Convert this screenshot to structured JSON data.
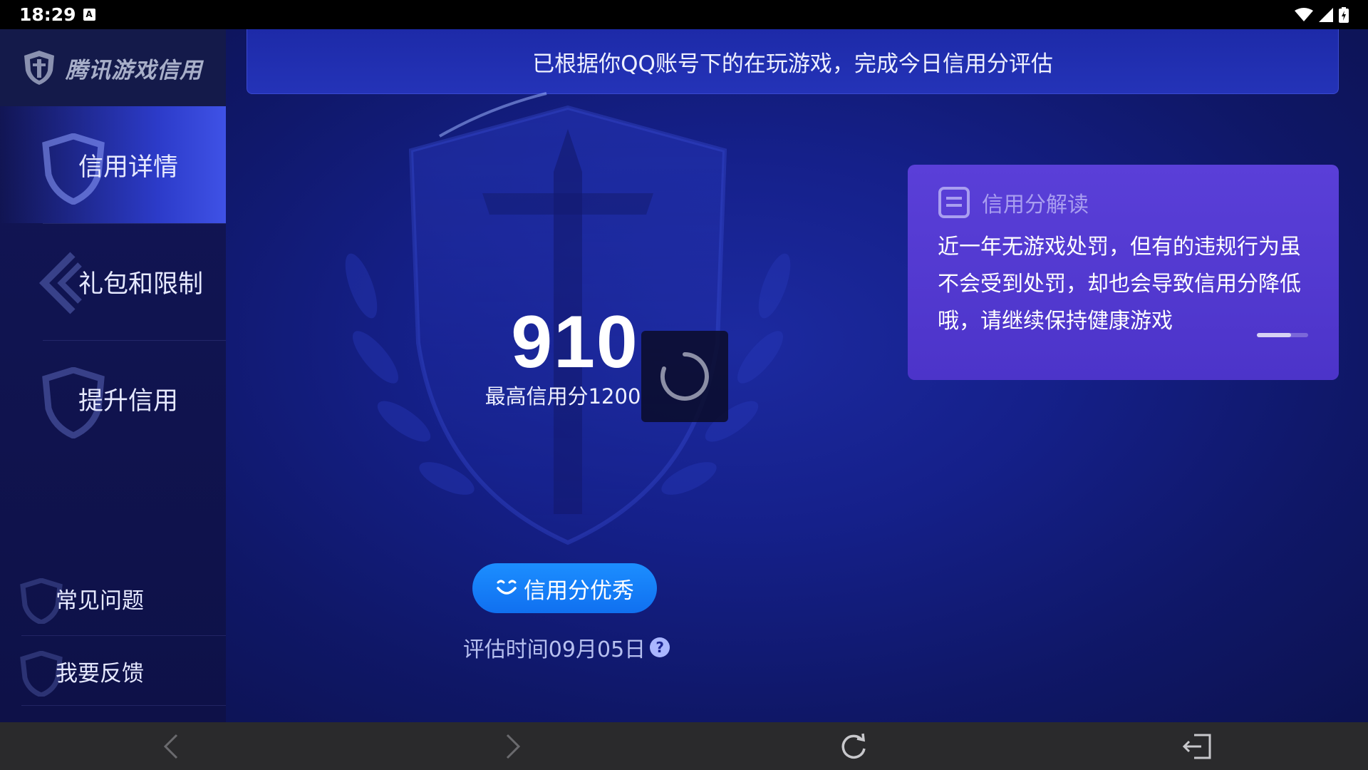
{
  "status_bar": {
    "time": "18:29",
    "notification_icon": "a-icon"
  },
  "sidebar": {
    "logo_text": "腾讯游戏信用",
    "nav_items": [
      {
        "label": "信用详情",
        "active": true
      },
      {
        "label": "礼包和限制",
        "active": false
      },
      {
        "label": "提升信用",
        "active": false
      }
    ],
    "bottom_items": [
      {
        "label": "常见问题"
      },
      {
        "label": "我要反馈"
      }
    ]
  },
  "main": {
    "banner_text": "已根据你QQ账号下的在玩游戏，完成今日信用分评估",
    "score": "910",
    "max_score_text": "最高信用分1200",
    "level_button": "信用分优秀",
    "eval_time": "评估时间09月05日"
  },
  "card": {
    "title": "信用分解读",
    "body": "近一年无游戏处罚，但有的违规行为虽不会受到处罚，却也会导致信用分降低哦，请继续保持健康游戏"
  },
  "colors": {
    "accent_blue": "#1c8eff",
    "card_purple": "#5a3fd8",
    "sidebar_active": "#3f52e6"
  }
}
